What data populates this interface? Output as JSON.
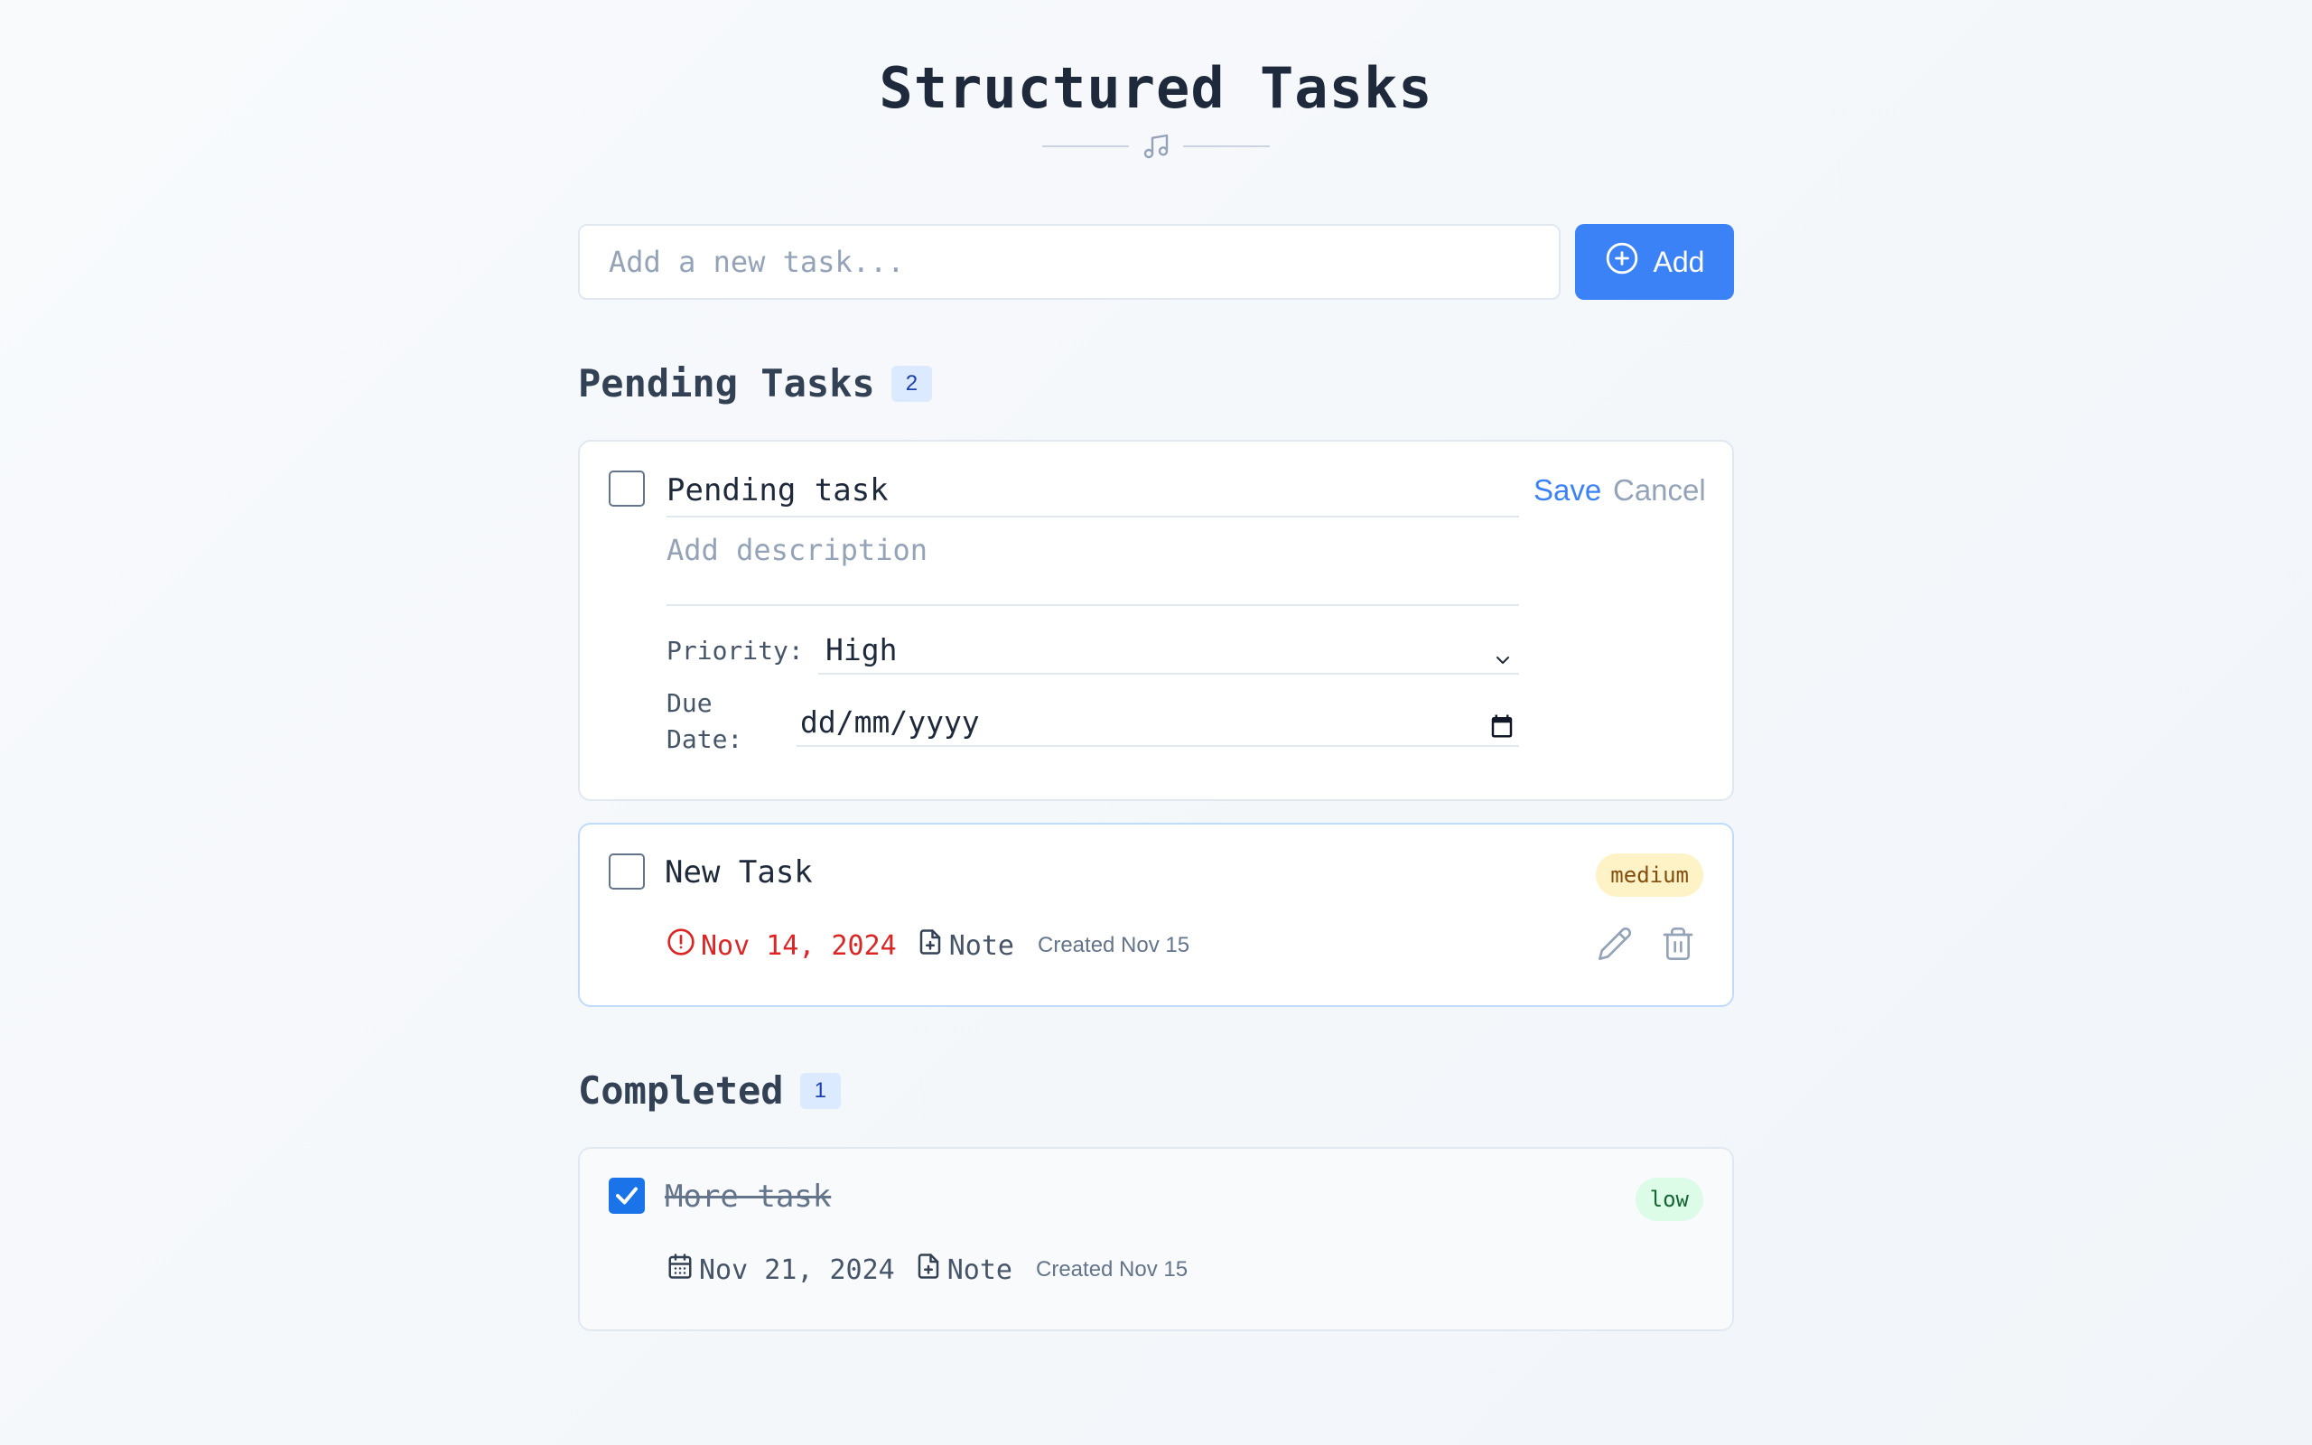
{
  "app": {
    "title": "Structured Tasks"
  },
  "add_task": {
    "placeholder": "Add a new task...",
    "button_label": "Add"
  },
  "pending": {
    "heading": "Pending Tasks",
    "count": "2",
    "editing_task": {
      "title": "Pending task",
      "save_label": "Save",
      "cancel_label": "Cancel",
      "description_placeholder": "Add description",
      "priority_label": "Priority:",
      "priority_value": "High",
      "due_label_line1": "Due",
      "due_label_line2": "Date:",
      "due_value": "dd/mm/yyyy"
    },
    "tasks": [
      {
        "title": "New Task",
        "priority": "medium",
        "due": "Nov 14, 2024",
        "note_label": "Note",
        "created": "Created Nov 15",
        "overdue": true
      }
    ]
  },
  "completed": {
    "heading": "Completed",
    "count": "1",
    "tasks": [
      {
        "title": "More task",
        "priority": "low",
        "due": "Nov 21, 2024",
        "note_label": "Note",
        "created": "Created Nov 15",
        "checked": true
      }
    ]
  },
  "colors": {
    "accent": "#3b82f6",
    "overdue": "#dc2626",
    "medium_badge_bg": "#fef3c7",
    "low_badge_bg": "#dcfce7"
  },
  "icons": {
    "header": "music-note-icon",
    "add": "plus-circle-icon",
    "overdue": "alert-circle-icon",
    "due": "calendar-icon",
    "note": "file-plus-icon",
    "edit": "pencil-icon",
    "delete": "trash-icon",
    "priority_dropdown": "chevron-down-icon",
    "date_picker": "calendar-picker-icon"
  }
}
